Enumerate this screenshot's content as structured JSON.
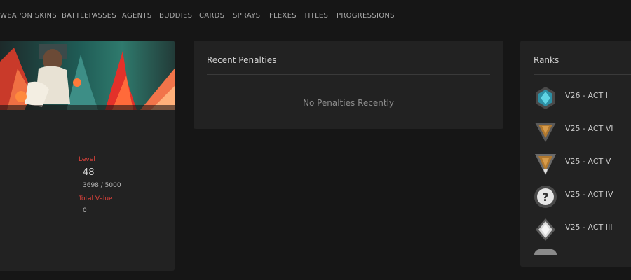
{
  "nav": {
    "items": [
      {
        "label": "WEAPON SKINS"
      },
      {
        "label": "BATTLEPASSES"
      },
      {
        "label": "AGENTS"
      },
      {
        "label": "BUDDIES"
      },
      {
        "label": "CARDS"
      },
      {
        "label": "SPRAYS"
      },
      {
        "label": "FLEXES"
      },
      {
        "label": "TITLES"
      },
      {
        "label": "PROGRESSIONS"
      }
    ]
  },
  "profile": {
    "level_label": "Level",
    "level": "48",
    "xp": "3698 / 5000",
    "total_value_label": "Total Value",
    "total_value": "0"
  },
  "penalties": {
    "title": "Recent Penalties",
    "empty_message": "No Penalties Recently"
  },
  "ranks": {
    "title": "Ranks",
    "items": [
      {
        "label": "V26 - ACT I",
        "icon": "rank-diamond-icon",
        "color": "#3fb6c9"
      },
      {
        "label": "V25 - ACT VI",
        "icon": "rank-bronze-icon",
        "color": "#b0782f"
      },
      {
        "label": "V25 - ACT V",
        "icon": "rank-bronze-icon",
        "color": "#b0782f"
      },
      {
        "label": "V25 - ACT IV",
        "icon": "rank-unranked-icon",
        "color": "#9a9a9a"
      },
      {
        "label": "V25 - ACT III",
        "icon": "rank-silver-icon",
        "color": "#d8d8d8"
      }
    ]
  },
  "colors": {
    "background": "#161616",
    "panel": "#222222",
    "accent": "#e2433c"
  }
}
